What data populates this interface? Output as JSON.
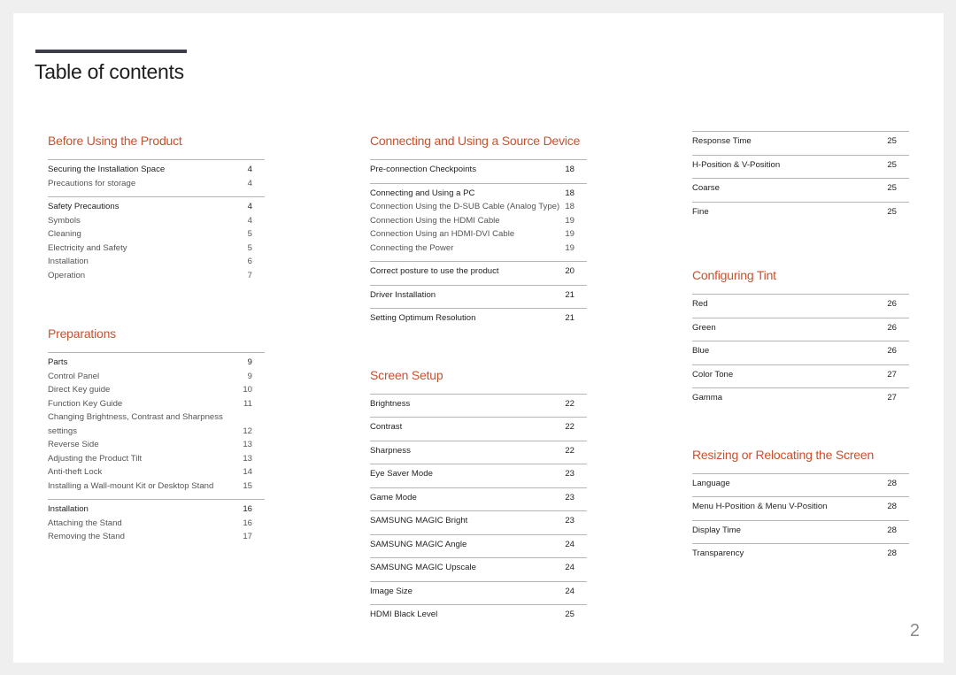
{
  "title": "Table of contents",
  "page_number": "2",
  "accent_color": "#c8512d",
  "columns": [
    [
      {
        "title": "Before Using the Product",
        "groups": [
          [
            {
              "label": "Securing the Installation Space",
              "page": "4",
              "main": true
            },
            {
              "label": "Precautions for storage",
              "page": "4"
            }
          ],
          [
            {
              "label": "Safety Precautions",
              "page": "4",
              "main": true
            },
            {
              "label": "Symbols",
              "page": "4"
            },
            {
              "label": "Cleaning",
              "page": "5"
            },
            {
              "label": "Electricity and Safety",
              "page": "5"
            },
            {
              "label": "Installation",
              "page": "6"
            },
            {
              "label": "Operation",
              "page": "7"
            }
          ]
        ]
      },
      {
        "title": "Preparations",
        "groups": [
          [
            {
              "label": "Parts",
              "page": "9",
              "main": true
            },
            {
              "label": "Control Panel",
              "page": "9"
            },
            {
              "label": "Direct Key guide",
              "page": "10"
            },
            {
              "label": "Function Key Guide",
              "page": "11"
            },
            {
              "label": "Changing Brightness, Contrast and Sharpness settings",
              "page": "12",
              "wrap": true
            },
            {
              "label": "Reverse Side",
              "page": "13"
            },
            {
              "label": "Adjusting the Product Tilt",
              "page": "13"
            },
            {
              "label": "Anti-theft Lock",
              "page": "14"
            },
            {
              "label": "Installing a Wall-mount Kit or Desktop Stand",
              "page": "15"
            }
          ],
          [
            {
              "label": "Installation",
              "page": "16",
              "main": true
            },
            {
              "label": "Attaching the Stand",
              "page": "16"
            },
            {
              "label": "Removing the Stand",
              "page": "17"
            }
          ]
        ]
      }
    ],
    [
      {
        "title": "Connecting and Using a Source Device",
        "groups": [
          [
            {
              "label": "Pre-connection Checkpoints",
              "page": "18",
              "main": true
            }
          ],
          [
            {
              "label": "Connecting and Using a PC",
              "page": "18",
              "main": true
            },
            {
              "label": "Connection Using the D-SUB Cable (Analog Type)",
              "page": "18"
            },
            {
              "label": "Connection Using the HDMI Cable",
              "page": "19"
            },
            {
              "label": "Connection Using an HDMI-DVI Cable",
              "page": "19"
            },
            {
              "label": "Connecting the Power",
              "page": "19"
            }
          ],
          [
            {
              "label": "Correct posture to use the product",
              "page": "20",
              "main": true
            }
          ],
          [
            {
              "label": "Driver Installation",
              "page": "21",
              "main": true
            }
          ],
          [
            {
              "label": "Setting Optimum Resolution",
              "page": "21",
              "main": true
            }
          ]
        ]
      },
      {
        "title": "Screen Setup",
        "groups": [
          [
            {
              "label": "Brightness",
              "page": "22",
              "main": true
            }
          ],
          [
            {
              "label": "Contrast",
              "page": "22",
              "main": true
            }
          ],
          [
            {
              "label": "Sharpness",
              "page": "22",
              "main": true
            }
          ],
          [
            {
              "label": "Eye Saver Mode",
              "page": "23",
              "main": true
            }
          ],
          [
            {
              "label": "Game Mode",
              "page": "23",
              "main": true
            }
          ],
          [
            {
              "label": "SAMSUNG MAGIC Bright",
              "page": "23",
              "main": true
            }
          ],
          [
            {
              "label": "SAMSUNG MAGIC Angle",
              "page": "24",
              "main": true
            }
          ],
          [
            {
              "label": "SAMSUNG MAGIC Upscale",
              "page": "24",
              "main": true
            }
          ],
          [
            {
              "label": "Image Size",
              "page": "24",
              "main": true
            }
          ],
          [
            {
              "label": "HDMI Black Level",
              "page": "25",
              "main": true
            }
          ]
        ]
      }
    ],
    [
      {
        "title": "",
        "groups": [
          [
            {
              "label": "Response Time",
              "page": "25",
              "main": true
            }
          ],
          [
            {
              "label": "H-Position & V-Position",
              "page": "25",
              "main": true
            }
          ],
          [
            {
              "label": "Coarse",
              "page": "25",
              "main": true
            }
          ],
          [
            {
              "label": "Fine",
              "page": "25",
              "main": true
            }
          ]
        ]
      },
      {
        "title": "Configuring Tint",
        "groups": [
          [
            {
              "label": "Red",
              "page": "26",
              "main": true
            }
          ],
          [
            {
              "label": "Green",
              "page": "26",
              "main": true
            }
          ],
          [
            {
              "label": "Blue",
              "page": "26",
              "main": true
            }
          ],
          [
            {
              "label": "Color Tone",
              "page": "27",
              "main": true
            }
          ],
          [
            {
              "label": "Gamma",
              "page": "27",
              "main": true
            }
          ]
        ]
      },
      {
        "title": "Resizing or Relocating the Screen",
        "groups": [
          [
            {
              "label": "Language",
              "page": "28",
              "main": true
            }
          ],
          [
            {
              "label": "Menu H-Position & Menu V-Position",
              "page": "28",
              "main": true
            }
          ],
          [
            {
              "label": "Display Time",
              "page": "28",
              "main": true
            }
          ],
          [
            {
              "label": "Transparency",
              "page": "28",
              "main": true
            }
          ]
        ]
      }
    ]
  ]
}
